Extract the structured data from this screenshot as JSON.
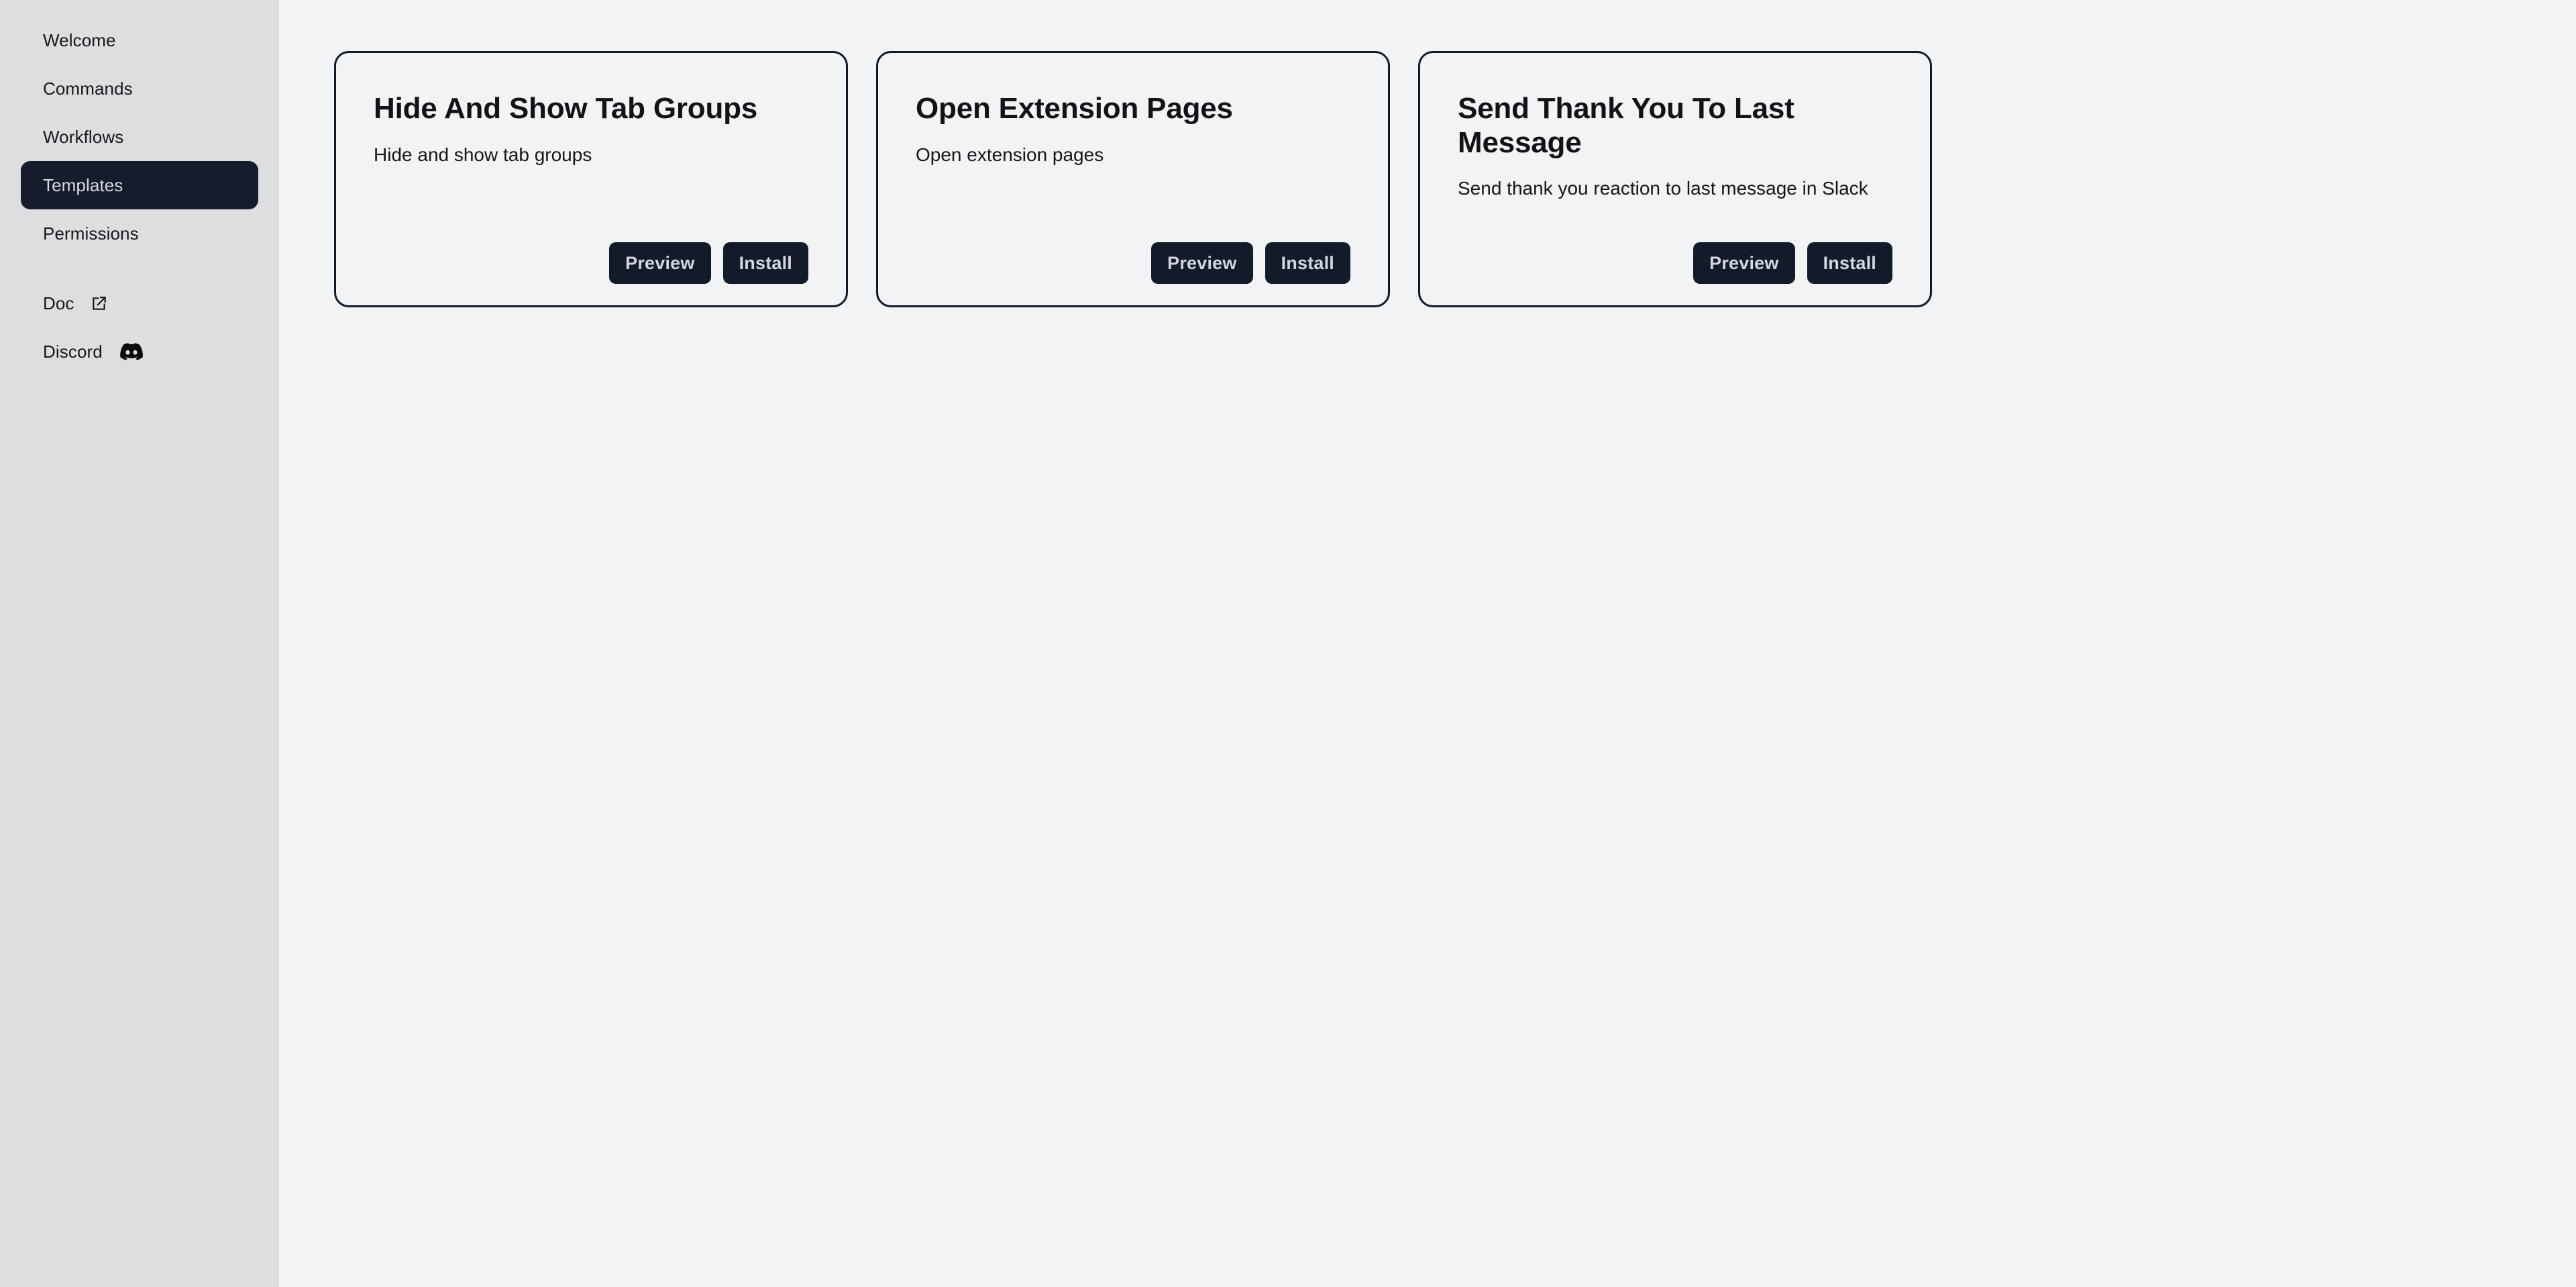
{
  "sidebar": {
    "items": [
      {
        "label": "Welcome",
        "active": false,
        "icon": null
      },
      {
        "label": "Commands",
        "active": false,
        "icon": null
      },
      {
        "label": "Workflows",
        "active": false,
        "icon": null
      },
      {
        "label": "Templates",
        "active": true,
        "icon": null
      },
      {
        "label": "Permissions",
        "active": false,
        "icon": null
      }
    ],
    "external_items": [
      {
        "label": "Doc",
        "icon": "external-link-icon"
      },
      {
        "label": "Discord",
        "icon": "discord-icon"
      }
    ]
  },
  "main": {
    "cards": [
      {
        "title": "Hide And Show Tab Groups",
        "description": "Hide and show tab groups",
        "preview_label": "Preview",
        "install_label": "Install"
      },
      {
        "title": "Open Extension Pages",
        "description": "Open extension pages",
        "preview_label": "Preview",
        "install_label": "Install"
      },
      {
        "title": "Send Thank You To Last Message",
        "description": "Send thank you reaction to last message in Slack",
        "preview_label": "Preview",
        "install_label": "Install"
      }
    ]
  },
  "colors": {
    "sidebar_bg": "#dcdee0",
    "main_bg": "#f1f3f5",
    "accent_dark": "#151c2c",
    "card_border": "#121a2a",
    "button_bg": "#131a29",
    "button_text": "#d3d7de"
  }
}
